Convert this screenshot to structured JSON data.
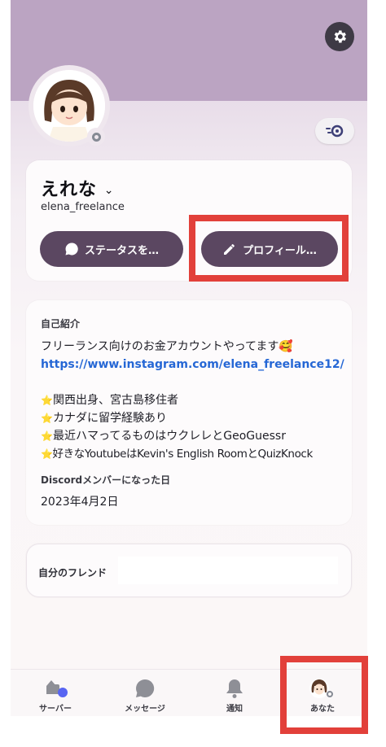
{
  "profile": {
    "display_name": "えれな",
    "username": "elena_freelance"
  },
  "actions": {
    "status_label": "ステータスを…",
    "edit_profile_label": "プロフィール…"
  },
  "about": {
    "heading": "自己紹介",
    "line1": "フリーランス向けのお金アカウントやってます🥰",
    "link": "https://www.instagram.com/elena_freelance12/",
    "items": [
      "関西出身、宮古島移住者",
      "カナダに留学経験あり",
      "最近ハマってるものはウクレレとGeoGuessr",
      "好きなYoutubeはKevin's English RoomとQuizKnock"
    ],
    "member_since_heading": "Discordメンバーになった日",
    "member_since": "2023年4月2日"
  },
  "friends": {
    "heading": "自分のフレンド"
  },
  "tabs": [
    {
      "label": "サーバー",
      "icon": "servers-icon"
    },
    {
      "label": "メッセージ",
      "icon": "messages-icon"
    },
    {
      "label": "通知",
      "icon": "bell-icon"
    },
    {
      "label": "あなた",
      "icon": "avatar-icon"
    }
  ],
  "colors": {
    "header": "#bba4c2",
    "button": "#5b4761",
    "link": "#2567d5",
    "highlight": "#e2403a",
    "notification_dot": "#5865f2"
  }
}
